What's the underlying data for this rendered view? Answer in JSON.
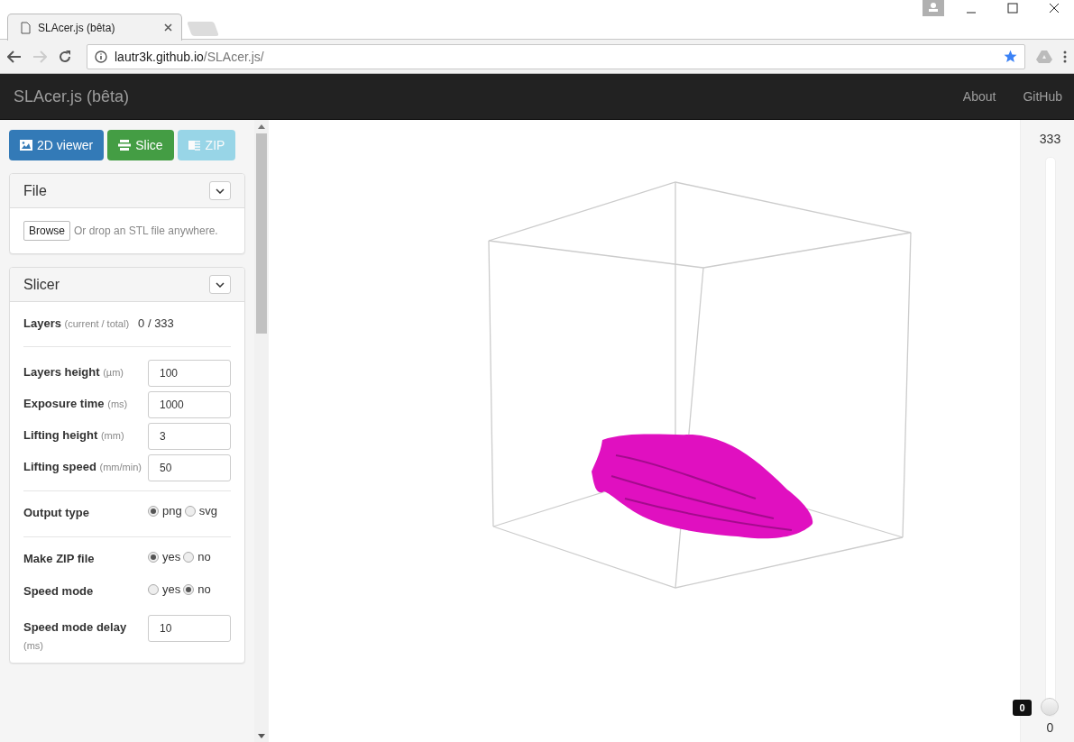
{
  "browser": {
    "tab_title": "SLAcer.js (bêta)",
    "url_host": "lautr3k.github.io",
    "url_path": "/SLAcer.js/"
  },
  "navbar": {
    "brand": "SLAcer.js (bêta)",
    "links": [
      "About",
      "GitHub"
    ]
  },
  "toolbar": [
    {
      "kind": "viewer",
      "label": "2D viewer",
      "disabled": false
    },
    {
      "kind": "slice",
      "label": "Slice",
      "disabled": false
    },
    {
      "kind": "zip",
      "label": "ZIP",
      "disabled": true
    }
  ],
  "file_panel": {
    "title": "File",
    "browse": "Browse",
    "hint": "Or drop an STL file anywhere."
  },
  "slicer_panel": {
    "title": "Slicer",
    "rows": [
      {
        "kind": "info",
        "label": "Layers",
        "unit": "(current / total)",
        "value": "0 / 333"
      },
      {
        "kind": "divider"
      },
      {
        "kind": "field",
        "label": "Layers height",
        "unit": "(µm)",
        "value": "100"
      },
      {
        "kind": "field",
        "label": "Exposure time",
        "unit": "(ms)",
        "value": "1000"
      },
      {
        "kind": "field",
        "label": "Lifting height",
        "unit": "(mm)",
        "value": "3"
      },
      {
        "kind": "field",
        "label": "Lifting speed",
        "unit": "(mm/min)",
        "value": "50"
      },
      {
        "kind": "divider"
      },
      {
        "kind": "radio",
        "label": "Output type",
        "options": [
          {
            "label": "png",
            "selected": true
          },
          {
            "label": "svg",
            "selected": false
          }
        ]
      },
      {
        "kind": "divider"
      },
      {
        "kind": "radio",
        "label": "Make ZIP file",
        "options": [
          {
            "label": "yes",
            "selected": true
          },
          {
            "label": "no",
            "selected": false
          }
        ]
      },
      {
        "kind": "radio",
        "label": "Speed mode",
        "options": [
          {
            "label": "yes",
            "selected": false
          },
          {
            "label": "no",
            "selected": true
          }
        ]
      },
      {
        "kind": "field",
        "label": "Speed mode delay",
        "unit": "(ms)",
        "value": "10"
      }
    ]
  },
  "layer_slider": {
    "max_label": "333",
    "min_label": "0",
    "tooltip": "0",
    "level": 0
  }
}
